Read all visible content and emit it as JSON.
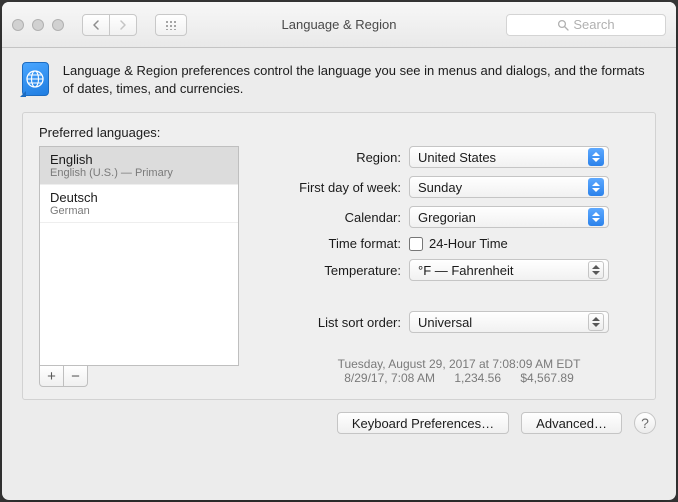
{
  "titlebar": {
    "title": "Language & Region",
    "search_placeholder": "Search"
  },
  "description": "Language & Region preferences control the language you see in menus and dialogs, and the formats of dates, times, and currencies.",
  "panel": {
    "preferred_label": "Preferred languages:",
    "languages": [
      {
        "primary": "English",
        "secondary": "English (U.S.) — Primary"
      },
      {
        "primary": "Deutsch",
        "secondary": "German"
      }
    ]
  },
  "form": {
    "region_label": "Region:",
    "region_value": "United States",
    "firstday_label": "First day of week:",
    "firstday_value": "Sunday",
    "calendar_label": "Calendar:",
    "calendar_value": "Gregorian",
    "timeformat_label": "Time format:",
    "timeformat_option": "24-Hour Time",
    "temperature_label": "Temperature:",
    "temperature_value": "°F — Fahrenheit",
    "listsort_label": "List sort order:",
    "listsort_value": "Universal"
  },
  "example": {
    "line1": "Tuesday, August 29, 2017 at 7:08:09 AM EDT",
    "short_date": "8/29/17, 7:08 AM",
    "number": "1,234.56",
    "currency": "$4,567.89"
  },
  "buttons": {
    "keyboard": "Keyboard Preferences…",
    "advanced": "Advanced…"
  }
}
